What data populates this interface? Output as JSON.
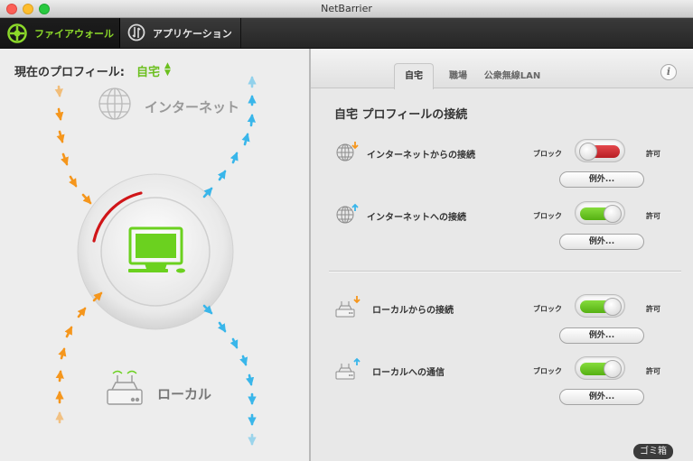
{
  "window": {
    "title": "NetBarrier"
  },
  "toolbar": {
    "tabs": [
      {
        "label": "ファイアウォール",
        "icon": "firewall-icon",
        "active": true
      },
      {
        "label": "アプリケーション",
        "icon": "application-icon",
        "active": false
      }
    ]
  },
  "profile": {
    "label": "現在のプロフィール:",
    "value": "自宅",
    "icon": "updown-chevron-icon"
  },
  "diagram": {
    "internet_label": "インターネット",
    "local_label": "ローカル",
    "colors": {
      "incoming": "#f5961c",
      "outgoing": "#39b6ea",
      "alert_arc": "#d01518",
      "device": "#6bd11f"
    }
  },
  "profile_tabs": [
    {
      "label": "自宅",
      "active": true
    },
    {
      "label": "職場",
      "active": false
    },
    {
      "label": "公衆無線LAN",
      "active": false
    }
  ],
  "info_button": "i",
  "section_title": "自宅 プロフィールの接続",
  "rules": [
    {
      "label": "インターネットからの接続",
      "block": "ブロック",
      "allow": "許可",
      "state": "block",
      "button": "例外...",
      "icon": "globe-incoming-icon"
    },
    {
      "label": "インターネットへの接続",
      "block": "ブロック",
      "allow": "許可",
      "state": "allow",
      "button": "例外...",
      "icon": "globe-outgoing-icon"
    },
    {
      "label": "ローカルからの接続",
      "block": "ブロック",
      "allow": "許可",
      "state": "allow",
      "button": "例外...",
      "icon": "router-incoming-icon"
    },
    {
      "label": "ローカルへの通信",
      "block": "ブロック",
      "allow": "許可",
      "state": "allow",
      "button": "例外...",
      "icon": "router-outgoing-icon"
    }
  ],
  "dock": {
    "trash_label": "ゴミ箱"
  }
}
